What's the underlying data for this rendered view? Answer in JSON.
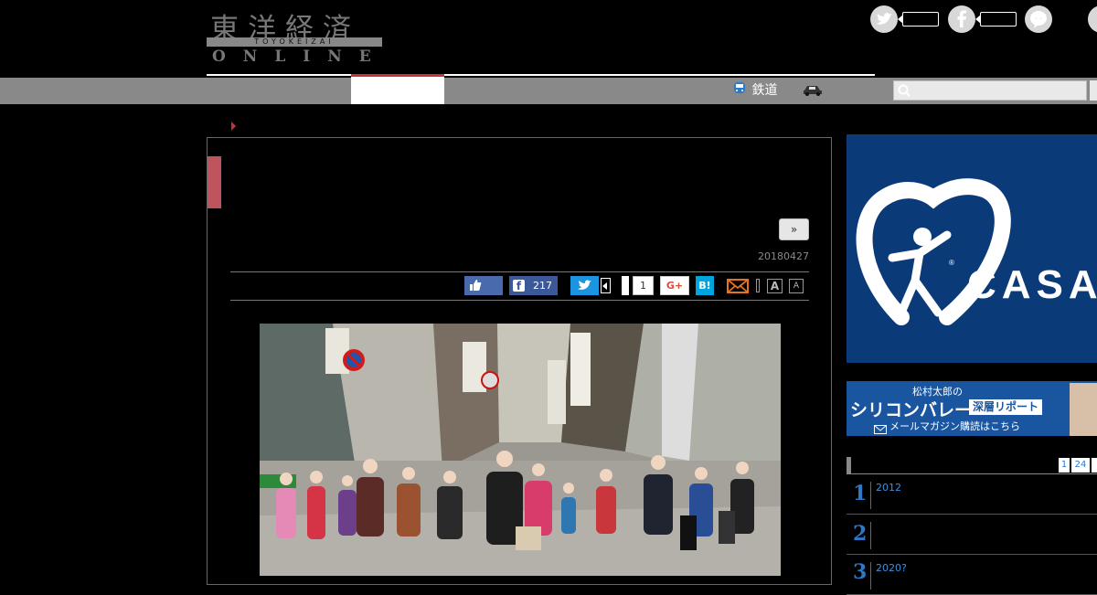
{
  "logo": {
    "kanji": "東洋経済",
    "romaji": "TOYOKEIZAI",
    "online": "ONLINE"
  },
  "nav": {
    "items": [
      {
        "label": "鉄道",
        "icon": "train-icon"
      },
      {
        "label": "",
        "icon": "car-icon"
      }
    ]
  },
  "search": {
    "placeholder": ""
  },
  "article": {
    "date": "20180427",
    "next_label": "»"
  },
  "share": {
    "facebook_count": "217",
    "pocket_count": "1",
    "gplus_label": "G+",
    "hatena_label": "B!",
    "font_large": "A",
    "font_small": "A"
  },
  "sidebar": {
    "ad_brand": "CASA",
    "banner": {
      "line1": "松村太郎の",
      "line2": "シリコンバレー",
      "tag": "深層リポート",
      "line3": "メールマガジン購読はこちら"
    },
    "ranking": {
      "tabs": [
        "1",
        "24"
      ],
      "items": [
        {
          "rank": "1",
          "text": "2012"
        },
        {
          "rank": "2",
          "text": ""
        },
        {
          "rank": "3",
          "text": "2020?"
        }
      ]
    }
  },
  "colors": {
    "accent": "#c4323a",
    "sidebar_blue": "#0b3a78",
    "link_blue": "#3f8fd9"
  }
}
